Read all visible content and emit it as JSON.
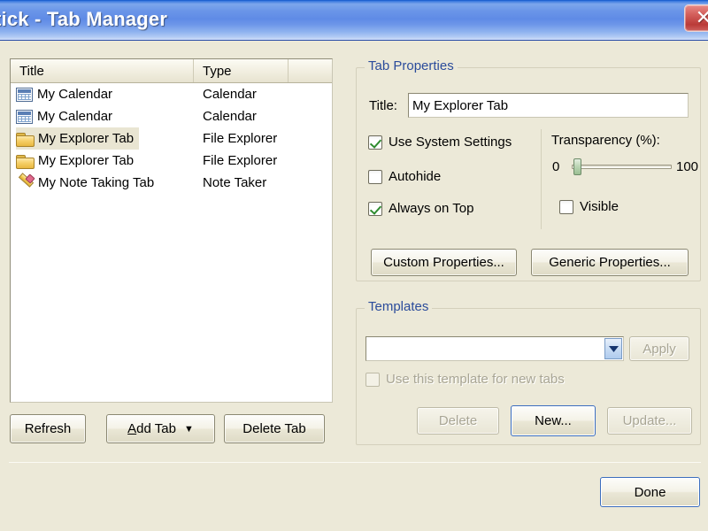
{
  "window": {
    "title": "tick - Tab Manager",
    "close_icon": "close-icon",
    "close_glyph": "✕"
  },
  "tab_list": {
    "columns": [
      "Title",
      "Type",
      ""
    ],
    "rows": [
      {
        "icon": "calendar-icon",
        "title": "My Calendar",
        "type": "Calendar",
        "selected": false
      },
      {
        "icon": "calendar-icon",
        "title": "My Calendar",
        "type": "Calendar",
        "selected": false
      },
      {
        "icon": "folder-icon",
        "title": "My Explorer Tab",
        "type": "File Explorer",
        "selected": true
      },
      {
        "icon": "folder-icon",
        "title": "My Explorer Tab",
        "type": "File Explorer",
        "selected": false
      },
      {
        "icon": "pencil-icon",
        "title": "My Note Taking Tab",
        "type": "Note Taker",
        "selected": false
      }
    ]
  },
  "list_buttons": {
    "refresh": "Refresh",
    "add_tab": "Add Tab",
    "add_tab_accel": "A",
    "add_tab_rest": "dd Tab",
    "add_tab_arrow": "▼",
    "delete_tab": "Delete Tab"
  },
  "tab_properties": {
    "legend": "Tab Properties",
    "title_label": "Title:",
    "title_value": "My Explorer Tab",
    "title_placeholder": "",
    "checkboxes": [
      {
        "label": "Use System Settings",
        "checked": true,
        "enabled": true
      },
      {
        "label": "Autohide",
        "checked": false,
        "enabled": true
      },
      {
        "label": "Always on Top",
        "checked": true,
        "enabled": true
      }
    ],
    "transparency_label": "Transparency (%):",
    "transparency_min": "0",
    "transparency_max": "100",
    "transparency_value": 2,
    "visible_checkbox": {
      "label": "Visible",
      "checked": false,
      "enabled": true
    },
    "custom_properties_button": "Custom Properties...",
    "generic_properties_button": "Generic Properties..."
  },
  "templates": {
    "legend": "Templates",
    "combo_value": "",
    "combo_arrow": "⌄",
    "apply_button": "Apply",
    "apply_enabled": false,
    "use_for_new_tabs": "Use this template for new tabs",
    "use_for_new_tabs_checked": false,
    "delete_button": "Delete",
    "delete_enabled": false,
    "new_button": "New...",
    "new_enabled": true,
    "update_button": "Update...",
    "update_enabled": false
  },
  "footer": {
    "done_button": "Done"
  },
  "colors": {
    "window_background": "#ECE9D8",
    "titlebar_blue": "#5F8BE6",
    "legend_blue": "#2B4C9B",
    "close_red": "#BA3B38",
    "selection": "#E9E5D2"
  }
}
